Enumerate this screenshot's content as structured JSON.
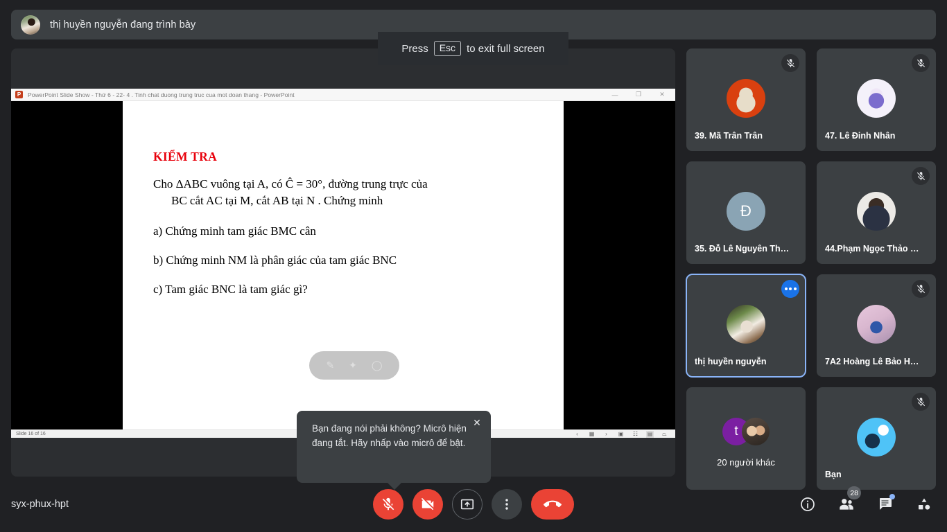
{
  "banner": {
    "presenting_text": "thị huyền nguyễn đang trình bày",
    "avatar_name": "presenter-avatar"
  },
  "esc_hint": {
    "prefix": "Press",
    "key": "Esc",
    "suffix": "to exit full screen"
  },
  "powerpoint": {
    "title": "PowerPoint Slide Show  -  Thứ 6  - 22- 4 . Tinh chat duong trung truc cua mot doan thang - PowerPoint",
    "minimize": "—",
    "restore": "❐",
    "close": "✕",
    "slide_status": "Slide 16 of 16",
    "slide": {
      "title": "KIỂM TRA",
      "paragraph_line1": "Cho ΔABC vuông tại A, có Ĉ = 30°, đường trung trực của",
      "paragraph_line2": "BC cắt AC tại M, cắt AB tại N . Chứng minh",
      "items": [
        "a)  Chứng minh tam giác BMC cân",
        "b)  Chứng minh NM là phân giác của tam giác BNC",
        "c)  Tam giác BNC là tam giác gì?"
      ]
    },
    "presenter_overlay": [
      "pen-icon",
      "pointer-icon",
      "menu-icon"
    ],
    "statusbar_icons": [
      "prev-slide-icon",
      "slide-thumb-icon",
      "next-slide-icon",
      "normal-view-icon",
      "slide-sorter-icon",
      "reading-view-icon",
      "slideshow-icon"
    ]
  },
  "mic_tooltip": {
    "text": "Bạn đang nói phải không? Micrô hiện đang tắt. Hãy nhấp vào micrô để bật.",
    "close_label": "✕"
  },
  "participants": [
    {
      "name": "39. Mã Trân Trân",
      "avatar_class": "av-cat",
      "avatar_letter": "",
      "muted": true,
      "active": false,
      "is_group": false
    },
    {
      "name": "47. Lê Đinh Nhân",
      "avatar_class": "av-anime",
      "avatar_letter": "",
      "muted": true,
      "active": false,
      "is_group": false
    },
    {
      "name": "35. Đỗ Lê Nguyên Th…",
      "avatar_class": "av-letter",
      "avatar_letter": "Đ",
      "muted": false,
      "active": false,
      "is_group": false
    },
    {
      "name": "44.Phạm Ngọc Thảo …",
      "avatar_class": "av-boy",
      "avatar_letter": "",
      "muted": true,
      "active": false,
      "is_group": false
    },
    {
      "name": "thị huyền nguyễn",
      "avatar_class": "av-girl",
      "avatar_letter": "",
      "muted": false,
      "active": true,
      "is_group": false
    },
    {
      "name": "7A2 Hoàng Lê Bảo H…",
      "avatar_class": "av-sakura",
      "avatar_letter": "",
      "muted": true,
      "active": false,
      "is_group": false
    },
    {
      "name": "20 người khác",
      "avatar_class": "av-purple",
      "avatar_letter": "t",
      "muted": false,
      "active": false,
      "is_group": true
    },
    {
      "name": "Bạn",
      "avatar_class": "av-eagle",
      "avatar_letter": "",
      "muted": true,
      "active": false,
      "is_group": false
    }
  ],
  "bottom_bar": {
    "meeting_code": "syx-phux-hpt",
    "controls": [
      {
        "name": "microphone-off-button",
        "style": "danger",
        "icon": "mic-off-icon"
      },
      {
        "name": "camera-off-button",
        "style": "danger",
        "icon": "camera-off-icon"
      },
      {
        "name": "present-screen-button",
        "style": "outlined",
        "icon": "present-screen-icon"
      },
      {
        "name": "more-options-button",
        "style": "neutral",
        "icon": "more-vertical-icon"
      },
      {
        "name": "leave-call-button",
        "style": "hangup",
        "icon": "phone-hangup-icon"
      }
    ],
    "right_buttons": [
      {
        "name": "meeting-details-button",
        "icon": "info-icon",
        "badge": ""
      },
      {
        "name": "show-everyone-button",
        "icon": "people-icon",
        "badge": "28"
      },
      {
        "name": "chat-button",
        "icon": "chat-icon",
        "badge": "dot"
      },
      {
        "name": "activities-button",
        "icon": "activities-icon",
        "badge": ""
      }
    ]
  },
  "colors": {
    "app_background": "#202124",
    "surface": "#3c4043",
    "stage": "#2c2e31",
    "accent": "#1a73e8",
    "active_outline": "#8ab4f8",
    "danger": "#ea4335",
    "slide_title_red": "#e8000b"
  }
}
